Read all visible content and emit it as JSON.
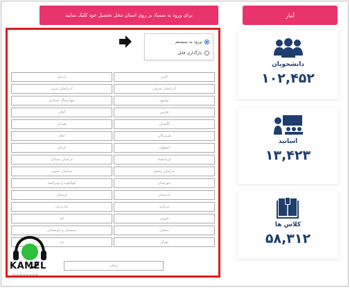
{
  "header": {
    "banner_text": "برای ورود به سمیاد بر روی استان محل تحصیل خود کلیک نمایید"
  },
  "login_modes": {
    "options": [
      {
        "label": "ورود به سیستم",
        "selected": true
      },
      {
        "label": "بازگذاری فایل",
        "selected": false
      }
    ]
  },
  "provinces": [
    "اردبیل",
    "البرز",
    "آذربایجان غربی",
    "آذربایجان شرقی",
    "چهارمحال بختیاری",
    "بوشهر",
    "گیلان",
    "فارس",
    "همدان",
    "گلستان",
    "ایلام",
    "هرمزگان",
    "کرمان",
    "اصفهان",
    "خراسان شمالی",
    "کرمانشاه",
    "خراسان جنوبی",
    "خراسان رضوی",
    "کهگیلویه و بویراحمد",
    "خوزستان",
    "لرستان",
    "کردستان",
    "مازندران",
    "مرکزی",
    "قم",
    "قزوین",
    "سیستان و بلوچستان",
    "سمنان",
    "یزد",
    "تهران"
  ],
  "last_province": "زنجان",
  "branding": {
    "logo_text": "KAMEL",
    "logo_subtext": "m.e.k.o.o.v.o.n"
  },
  "stats": {
    "title": "آمار",
    "items": [
      {
        "label": "دانشجویان",
        "value": "۱۰۲,۴۵۲",
        "icon": "students-group-icon"
      },
      {
        "label": "اساتید",
        "value": "۱۳,۴۲۳",
        "icon": "teacher-board-icon"
      },
      {
        "label": "کلاس ها",
        "value": "۵۸,۳۱۲",
        "icon": "book-icon"
      }
    ]
  },
  "colors": {
    "accent_pink": "#e8336c",
    "panel_border_red": "#d81e1e",
    "stats_navy": "#1f3e6e",
    "radio_blue": "#2a6fd6"
  }
}
